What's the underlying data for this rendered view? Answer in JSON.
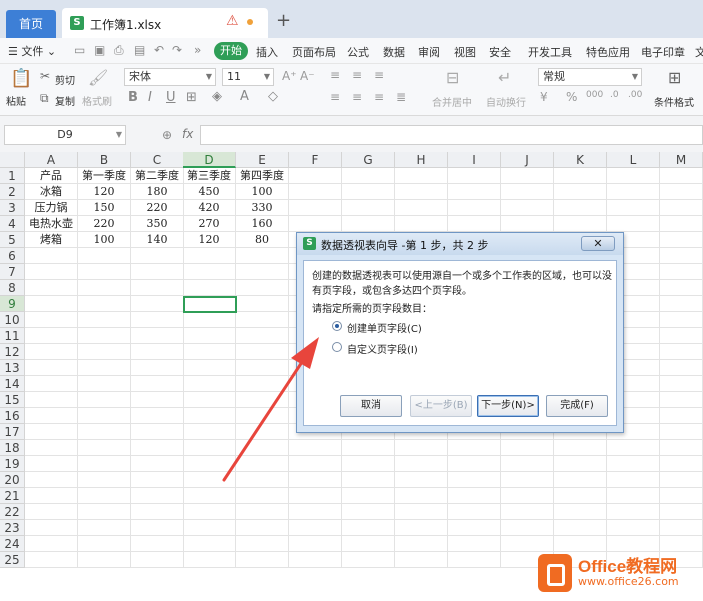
{
  "tabs": {
    "home": "首页",
    "file_name": "工作簿1.xlsx",
    "file_icon": "S",
    "add": "+"
  },
  "menu": {
    "file": "文件",
    "active": "开始",
    "items": [
      "插入",
      "页面布局",
      "公式",
      "数据",
      "审阅",
      "视图",
      "安全",
      "开发工具",
      "特色应用",
      "电子印章",
      "文"
    ]
  },
  "ribbon": {
    "paste": "粘贴",
    "cut": "剪切",
    "copy": "复制",
    "format_painter": "格式刷",
    "font_name": "宋体",
    "font_size": "11",
    "bold": "B",
    "italic": "I",
    "underline": "U",
    "merge_center": "合并居中",
    "wrap_text": "自动换行",
    "number_format": "常规",
    "conditional_format": "条件格式"
  },
  "formula_bar": {
    "name_box": "D9",
    "fx": "fx",
    "content": ""
  },
  "sheet": {
    "columns": [
      "A",
      "B",
      "C",
      "D",
      "E",
      "F",
      "G",
      "H",
      "I",
      "J",
      "K",
      "L",
      "M"
    ],
    "selected_column": "D",
    "rows": [
      "1",
      "2",
      "3",
      "4",
      "5",
      "6",
      "7",
      "8",
      "9",
      "10",
      "11",
      "12",
      "13",
      "14",
      "15",
      "16",
      "17",
      "18",
      "19",
      "20",
      "21",
      "22",
      "23",
      "24",
      "25"
    ],
    "selected_row": "9",
    "data": [
      [
        "产品",
        "第一季度",
        "第二季度",
        "第三季度",
        "第四季度"
      ],
      [
        "冰箱",
        "120",
        "180",
        "450",
        "100"
      ],
      [
        "压力锅",
        "150",
        "220",
        "420",
        "330"
      ],
      [
        "电热水壶",
        "220",
        "350",
        "270",
        "160"
      ],
      [
        "烤箱",
        "100",
        "140",
        "120",
        "80"
      ]
    ]
  },
  "dialog": {
    "title": "数据透视表向导 -第 1 步，共 2 步",
    "icon": "S",
    "close": "✕",
    "description": "创建的数据透视表可以使用源自一个或多个工作表的区域，也可以没有页字段，或包含多达四个页字段。",
    "prompt": "请指定所需的页字段数目：",
    "options": [
      {
        "label": "创建单页字段(C)",
        "selected": true
      },
      {
        "label": "自定义页字段(I)",
        "selected": false
      }
    ],
    "buttons": {
      "cancel": "取消",
      "back": "<上一步(B)",
      "next": "下一步(N)>",
      "finish": "完成(F)"
    }
  },
  "watermark": {
    "title": "Office教程网",
    "url": "www.office26.com"
  },
  "colors": {
    "accent_green": "#2f9e57",
    "tab_blue": "#3d7fd6",
    "arrow_red": "#e8453c",
    "watermark_orange": "#f06b22"
  }
}
